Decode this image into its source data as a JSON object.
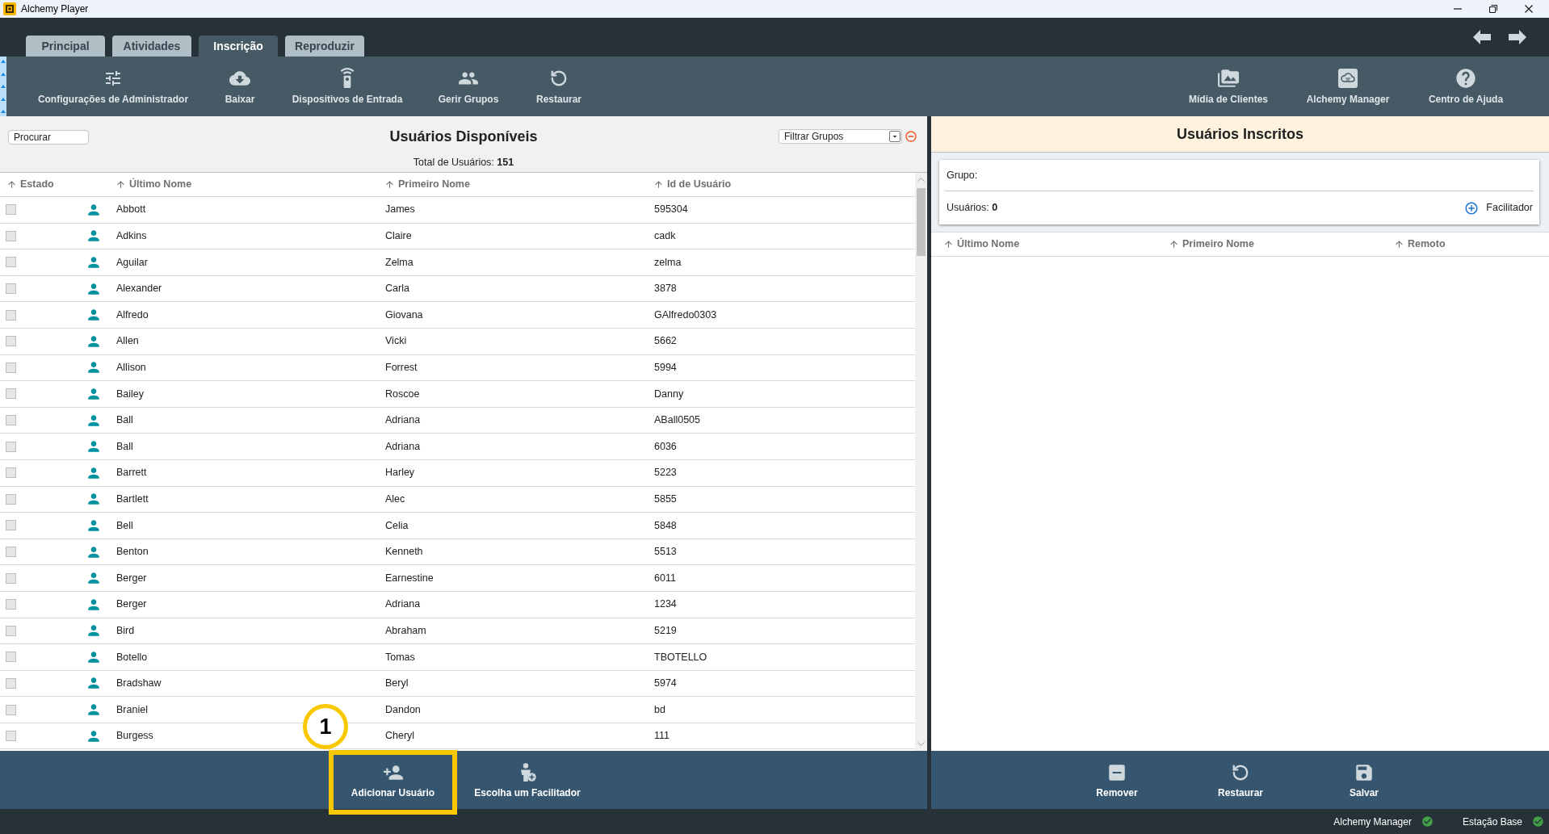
{
  "window": {
    "title": "Alchemy Player"
  },
  "tabs": [
    {
      "label": "Principal",
      "selected": false
    },
    {
      "label": "Atividades",
      "selected": false
    },
    {
      "label": "Inscrição",
      "selected": true
    },
    {
      "label": "Reproduzir",
      "selected": false
    }
  ],
  "toolbar_left": [
    "Configurações de Administrador",
    "Baixar",
    "Dispositivos de Entrada",
    "Gerir Grupos",
    "Restaurar"
  ],
  "toolbar_right": [
    "Mídia de Clientes",
    "Alchemy Manager",
    "Centro de Ajuda"
  ],
  "available_users": {
    "search": {
      "placeholder": "Procurar"
    },
    "title": "Usuários Disponíveis",
    "filter": {
      "placeholder": "Filtrar Grupos"
    },
    "total": "Total de Usuários: **151**",
    "columns": [
      "Estado",
      "Último Nome",
      "Primeiro Nome",
      "Id de Usuário"
    ],
    "rows": [
      {
        "checked": false,
        "last_name": "Abbott",
        "first_name": "James",
        "user_id": "595304"
      },
      {
        "checked": false,
        "last_name": "Adkins",
        "first_name": "Claire",
        "user_id": "cadk"
      },
      {
        "checked": false,
        "last_name": "Aguilar",
        "first_name": "Zelma",
        "user_id": "zelma"
      },
      {
        "checked": false,
        "last_name": "Alexander",
        "first_name": "Carla",
        "user_id": "3878"
      },
      {
        "checked": false,
        "last_name": "Alfredo",
        "first_name": "Giovana",
        "user_id": "GAlfredo0303"
      },
      {
        "checked": false,
        "last_name": "Allen",
        "first_name": "Vicki",
        "user_id": "5662"
      },
      {
        "checked": false,
        "last_name": "Allison",
        "first_name": "Forrest",
        "user_id": "5994"
      },
      {
        "checked": false,
        "last_name": "Bailey",
        "first_name": "Roscoe",
        "user_id": "Danny"
      },
      {
        "checked": false,
        "last_name": "Ball",
        "first_name": "Adriana",
        "user_id": "ABall0505"
      },
      {
        "checked": false,
        "last_name": "Ball",
        "first_name": "Adriana",
        "user_id": "6036"
      },
      {
        "checked": false,
        "last_name": "Barrett",
        "first_name": "Harley",
        "user_id": "5223"
      },
      {
        "checked": false,
        "last_name": "Bartlett",
        "first_name": "Alec",
        "user_id": "5855"
      },
      {
        "checked": false,
        "last_name": "Bell",
        "first_name": "Celia",
        "user_id": "5848"
      },
      {
        "checked": false,
        "last_name": "Benton",
        "first_name": "Kenneth",
        "user_id": "5513"
      },
      {
        "checked": false,
        "last_name": "Berger",
        "first_name": "Earnestine",
        "user_id": "6011"
      },
      {
        "checked": false,
        "last_name": "Berger",
        "first_name": "Adriana",
        "user_id": "1234"
      },
      {
        "checked": false,
        "last_name": "Bird",
        "first_name": "Abraham",
        "user_id": "5219"
      },
      {
        "checked": false,
        "last_name": "Botello",
        "first_name": "Tomas",
        "user_id": "TBOTELLO"
      },
      {
        "checked": false,
        "last_name": "Bradshaw",
        "first_name": "Beryl",
        "user_id": "5974"
      },
      {
        "checked": false,
        "last_name": "Braniel",
        "first_name": "Dandon",
        "user_id": "bd"
      },
      {
        "checked": false,
        "last_name": "Burgess",
        "first_name": "Cheryl",
        "user_id": "111"
      }
    ]
  },
  "enrolled_users": {
    "title": "Usuários Inscritos",
    "group_label": "Grupo:",
    "users_count": "Usuários: **0**",
    "facilitator_button": "Facilitador",
    "columns": [
      "Último Nome",
      "Primeiro Nome",
      "Remoto"
    ]
  },
  "bottom_left_actions": [
    {
      "label": "Adicionar Usuário",
      "highlighted": true,
      "callout": "1"
    },
    {
      "label": "Escolha um Facilitador",
      "highlighted": false
    }
  ],
  "bottom_right_actions": [
    {
      "label": "Remover"
    },
    {
      "label": "Restaurar"
    },
    {
      "label": "Salvar"
    }
  ],
  "status_bar": [
    {
      "label": "Alchemy Manager",
      "ok": true
    },
    {
      "label": "Estação Base",
      "ok": true
    }
  ]
}
